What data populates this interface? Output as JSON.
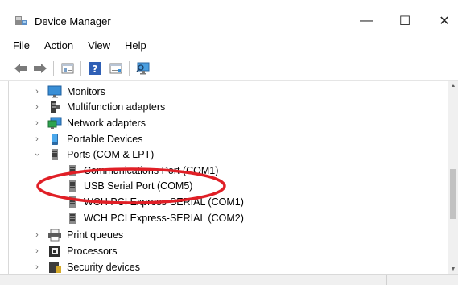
{
  "window": {
    "title": "Device Manager",
    "controls": {
      "minimize": "—",
      "maximize": "☐",
      "close": "✕"
    }
  },
  "menu": {
    "items": [
      "File",
      "Action",
      "View",
      "Help"
    ]
  },
  "toolbar": {
    "buttons": [
      "back-arrow-icon",
      "forward-arrow-icon",
      "properties-icon",
      "help-icon",
      "update-driver-icon",
      "monitor-scan-icon"
    ]
  },
  "tree": {
    "rows": [
      {
        "label": "Monitors",
        "state": "collapsed",
        "icon": "monitor-icon"
      },
      {
        "label": "Multifunction adapters",
        "state": "collapsed",
        "icon": "multifunction-icon"
      },
      {
        "label": "Network adapters",
        "state": "collapsed",
        "icon": "network-icon"
      },
      {
        "label": "Portable Devices",
        "state": "collapsed",
        "icon": "portable-device-icon"
      },
      {
        "label": "Ports (COM & LPT)",
        "state": "expanded",
        "icon": "port-icon"
      },
      {
        "label": "Communications Port (COM1)",
        "state": "child",
        "icon": "port-icon"
      },
      {
        "label": "USB Serial Port (COM5)",
        "state": "child",
        "icon": "port-icon"
      },
      {
        "label": "WCH PCI Express-SERIAL (COM1)",
        "state": "child",
        "icon": "port-icon"
      },
      {
        "label": "WCH PCI Express-SERIAL (COM2)",
        "state": "child",
        "icon": "port-icon"
      },
      {
        "label": "Print queues",
        "state": "collapsed",
        "icon": "printer-icon"
      },
      {
        "label": "Processors",
        "state": "collapsed",
        "icon": "processor-icon"
      },
      {
        "label": "Security devices",
        "state": "collapsed",
        "icon": "security-icon"
      }
    ]
  },
  "colors": {
    "annotation": "#e01f26",
    "monitor_blue": "#3a8fd6",
    "icon_gray": "#606060"
  }
}
